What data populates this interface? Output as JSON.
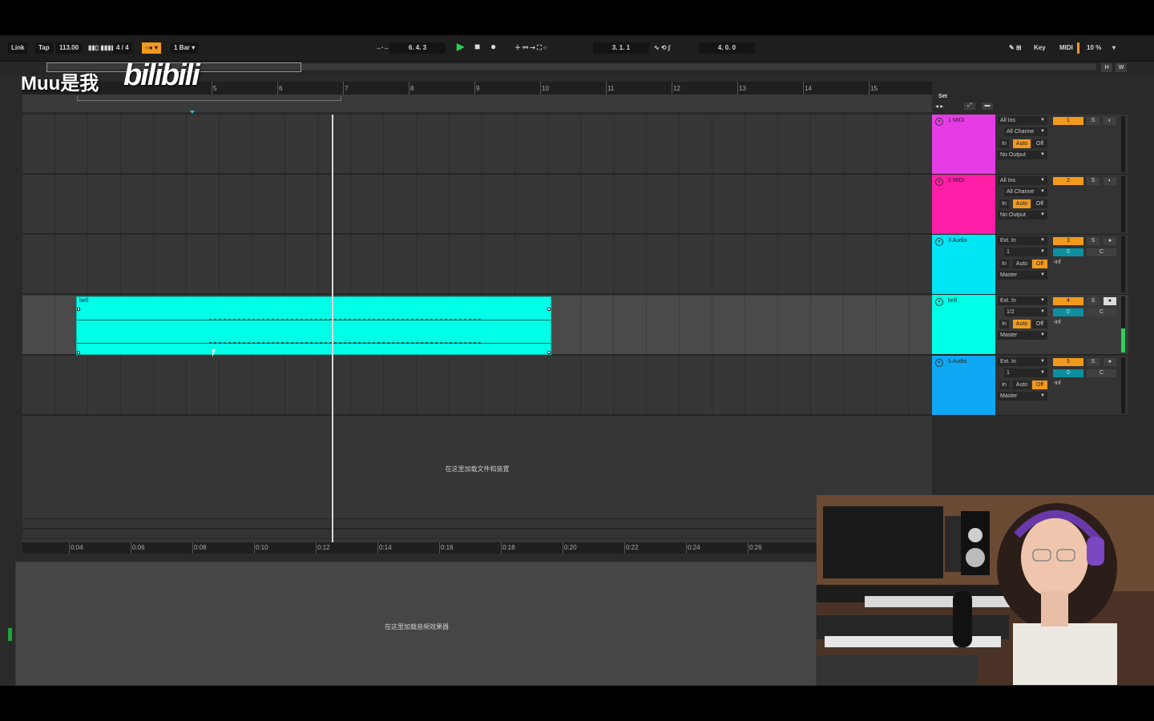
{
  "transport": {
    "link": "Link",
    "tap": "Tap",
    "tempo": "113.00",
    "signature": "4 / 4",
    "quantize": "1 Bar",
    "position": "6.  4.  3",
    "loop_start": "3.  1.  1",
    "loop_length": "4.  0.  0",
    "key": "Key",
    "midi": "MIDI",
    "cpu": "10 %"
  },
  "overview": {
    "h": "H",
    "w": "W"
  },
  "ruler": {
    "bars": [
      "5",
      "6",
      "7",
      "8",
      "9",
      "10",
      "11",
      "12",
      "13",
      "14",
      "15"
    ]
  },
  "timeaxis": {
    "labels": [
      "0:04",
      "0:06",
      "0:08",
      "0:10",
      "0:12",
      "0:14",
      "0:16",
      "0:18",
      "0:20",
      "0:22",
      "0:24",
      "0:26"
    ]
  },
  "clip": {
    "name": "bell"
  },
  "arrangement": {
    "drop_text": "在这里加载文件和装置"
  },
  "device": {
    "drop_text": "在这里加载音频效果器"
  },
  "set": {
    "label": "Set"
  },
  "tracks": [
    {
      "name": "1 MIDI",
      "color": "#e63ce6",
      "input": "All Ins",
      "channel": "All Channe",
      "monitor": [
        "In",
        "Auto",
        "Off"
      ],
      "output": "No Output",
      "number": "1",
      "solo": "S"
    },
    {
      "name": "2 MIDI",
      "color": "#ff1ea8",
      "input": "All Ins",
      "channel": "All Channe",
      "monitor": [
        "In",
        "Auto",
        "Off"
      ],
      "output": "No Output",
      "number": "2",
      "solo": "S"
    },
    {
      "name": "3 Audio",
      "color": "#00e6f5",
      "input": "Ext. In",
      "channel": "1",
      "monitor": [
        "In",
        "Auto",
        "Off"
      ],
      "output": "Master",
      "number": "3",
      "solo": "S",
      "volume": "0",
      "pan": "C",
      "peak": "-inf"
    },
    {
      "name": "bell",
      "color": "#00ffe6",
      "input": "Ext. In",
      "channel": "1/2",
      "monitor": [
        "In",
        "Auto",
        "Off"
      ],
      "output": "Master",
      "number": "4",
      "solo": "S",
      "volume": "0",
      "pan": "C",
      "peak": "-inf"
    },
    {
      "name": "5 Audio",
      "color": "#0ea8f5",
      "input": "Ext. In",
      "channel": "1",
      "monitor": [
        "In",
        "Auto",
        "Off"
      ],
      "output": "Master",
      "number": "5",
      "solo": "S",
      "volume": "0",
      "pan": "C",
      "peak": "-inf"
    }
  ],
  "watermark": {
    "text": "Muu是我",
    "logo": "bilibili"
  }
}
